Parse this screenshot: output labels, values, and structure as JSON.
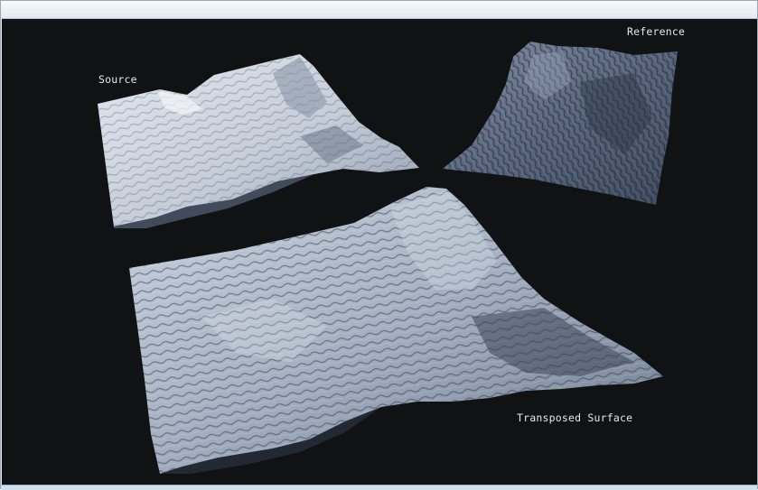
{
  "viewport": {
    "background": "#111214"
  },
  "labels": {
    "source": "Source",
    "reference": "Reference",
    "transposed": "Transposed Surface"
  },
  "colors": {
    "source_terrain": "#c9d2de",
    "reference_terrain": "#5d6b80",
    "transposed_terrain": "#a9b6c8",
    "label_text": "#e6e8ea"
  }
}
